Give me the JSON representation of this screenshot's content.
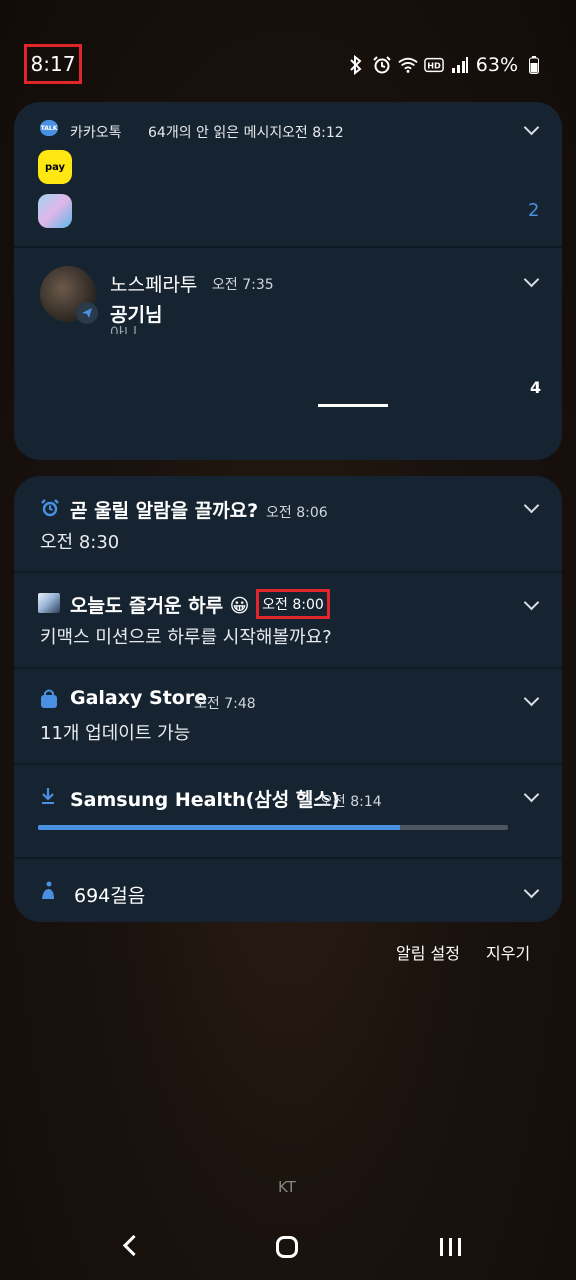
{
  "status_bar": {
    "time": "8:17",
    "battery": "63%",
    "icons": [
      "bluetooth-icon",
      "alarm-icon",
      "wifi-icon",
      "hd-icon",
      "signal-icon",
      "battery-icon"
    ]
  },
  "group1": {
    "kakao": {
      "app_name": "카카오톡",
      "summary": "64개의 안 읽은 메시지",
      "time": "오전 8:12",
      "pay_label": "pay",
      "count": "2"
    },
    "telegram": {
      "sender": "노스페라투",
      "time": "오전 7:35",
      "message": "공기님",
      "preview": "아니"
    },
    "page_count": "4"
  },
  "group2": {
    "alarm": {
      "title": "곧 울릴 알람을 끌까요?",
      "time": "오전 8:06",
      "body": "오전 8:30"
    },
    "kimax": {
      "title": "오늘도 즐거운 하루 😀",
      "time": "오전 8:00",
      "body": "키맥스 미션으로 하루를 시작해볼까요?"
    },
    "galaxy_store": {
      "title": "Galaxy Store",
      "time": "오전 7:48",
      "body": "11개 업데이트 가능"
    },
    "samsung_health": {
      "title": "Samsung Health(삼성 헬스)",
      "time": "오전 8:14",
      "progress": 0.77
    },
    "steps": {
      "label": "694걸음"
    }
  },
  "footer": {
    "settings": "알림 설정",
    "clear": "지우기",
    "carrier": "KT"
  },
  "colors": {
    "accent": "#4a90e2",
    "highlight": "#e0252b",
    "card": "#162431"
  }
}
